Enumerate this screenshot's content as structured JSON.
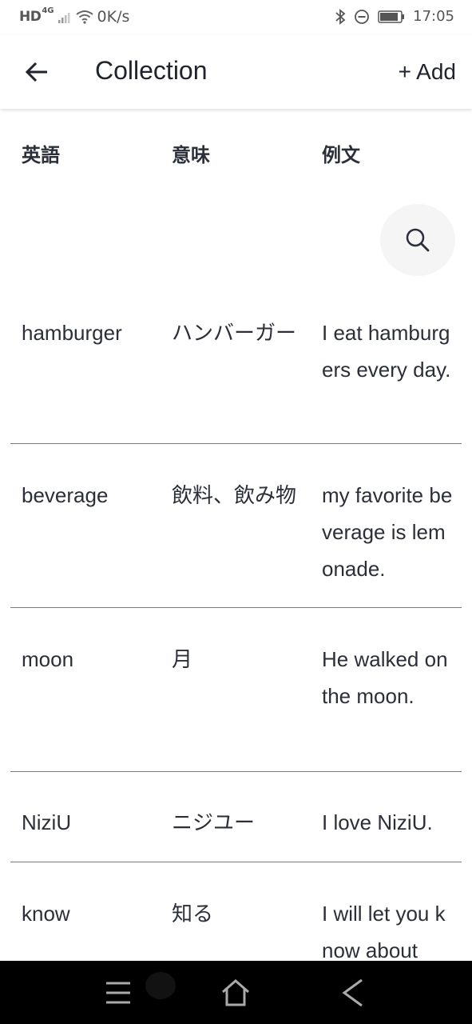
{
  "status_bar": {
    "network": "HD",
    "network_type": "4G",
    "speed": "0K/s",
    "time": "17:05"
  },
  "app_bar": {
    "title": "Collection",
    "add_label": "+ Add"
  },
  "table": {
    "headers": [
      "英語",
      "意味",
      "例文"
    ],
    "rows": [
      {
        "english": "hamburger",
        "meaning": "ハンバーガー",
        "example": "I eat hamburgers every day."
      },
      {
        "english": "beverage",
        "meaning": "飲料、飲み物",
        "example": "my favorite beverage is lemonade."
      },
      {
        "english": "moon",
        "meaning": "月",
        "example": "He walked on the moon."
      },
      {
        "english": "NiziU",
        "meaning": "ニジユー",
        "example": "I love NiziU."
      },
      {
        "english": "know",
        "meaning": "知る",
        "example": "I will let you know about"
      }
    ]
  },
  "icons": {
    "back": "arrow-left-icon",
    "search": "search-icon",
    "nav_menu": "menu-icon",
    "nav_home": "home-icon",
    "nav_back": "back-triangle-icon"
  },
  "colors": {
    "text": "#2b2f3a",
    "divider": "#7a7a7a",
    "search_bg": "#f5f5f5",
    "nav_bg": "#000000"
  }
}
